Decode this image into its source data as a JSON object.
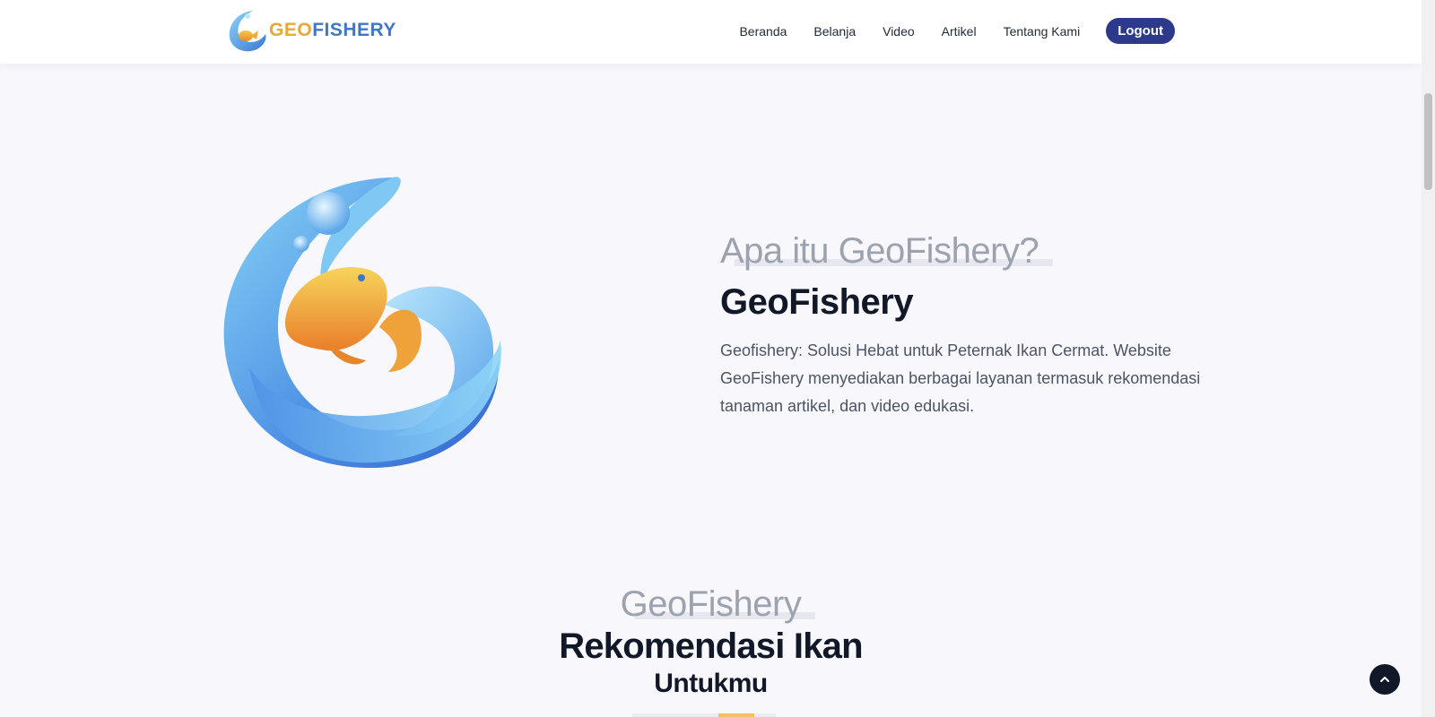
{
  "brand": {
    "geo": "GEO",
    "fishery": "FISHERY"
  },
  "nav": {
    "links": [
      "Beranda",
      "Belanja",
      "Video",
      "Artikel",
      "Tentang Kami"
    ],
    "logout": "Logout"
  },
  "about": {
    "eyebrow": "Apa itu GeoFishery?",
    "title": "GeoFishery",
    "description": "Geofishery: Solusi Hebat untuk Peternak Ikan Cermat. Website GeoFishery menyediakan berbagai layanan termasuk rekomendasi tanaman artikel, dan video edukasi."
  },
  "recommend": {
    "eyebrow": "GeoFishery",
    "title": "Rekomendasi Ikan",
    "subtitle": "Untukmu"
  },
  "colors": {
    "accent": "#2d3a8c",
    "brand_orange": "#e8a838",
    "brand_blue": "#3d79c7",
    "heading": "#111827"
  },
  "icons": {
    "logo": "geofishery-logo-icon",
    "hero": "fish-wave-illustration",
    "to_top": "chevron-up-icon"
  }
}
